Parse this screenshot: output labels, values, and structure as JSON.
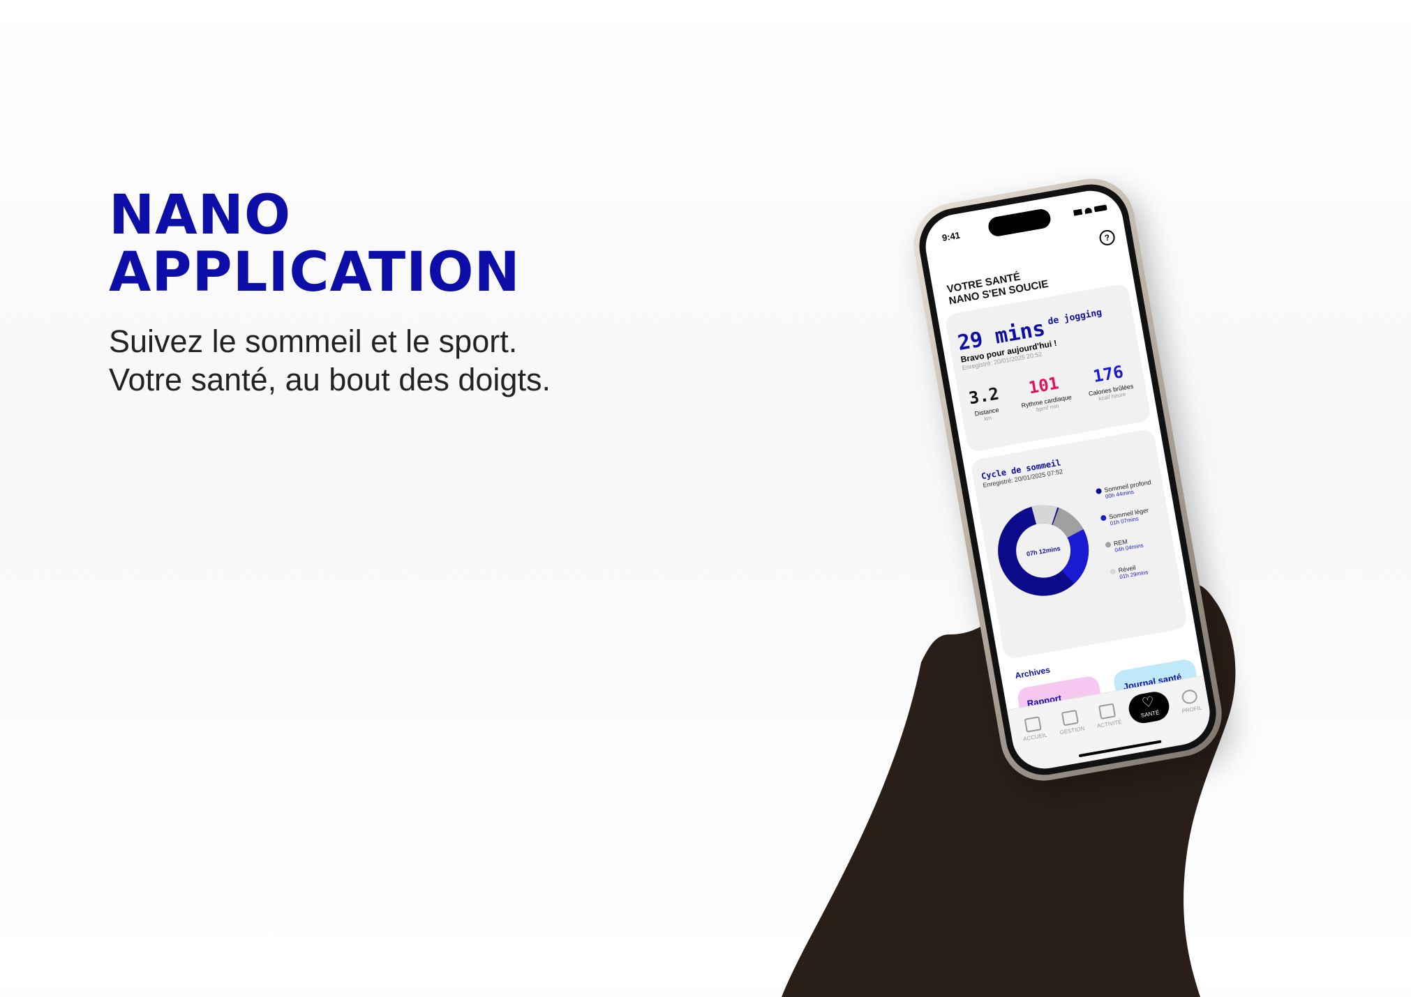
{
  "hero": {
    "title_line1": "NANO",
    "title_line2": "APPLICATION",
    "subtitle_line1": "Suivez le sommeil et le sport.",
    "subtitle_line2": "Votre santé, au bout des doigts."
  },
  "phone": {
    "status_time": "9:41",
    "help_label": "?",
    "header_line1": "VOTRE SANTÉ",
    "header_line2": "NANO S'EN SOUCIE",
    "activity": {
      "duration": "29 mins",
      "duration_suffix": "de jogging",
      "message": "Bravo pour aujourd'hui !",
      "recorded": "Enregistré: 20/01/2025  20:52",
      "stats": [
        {
          "value": "3.2",
          "label": "Distance",
          "unit": "km",
          "color": "#111111"
        },
        {
          "value": "101",
          "label": "Rythme cardiaque",
          "unit": "bpm/ min",
          "color": "#e0115f"
        },
        {
          "value": "176",
          "label": "Calories brûlées",
          "unit": "kcal/ heure",
          "color": "#1a1ad0"
        }
      ]
    },
    "sleep": {
      "title": "Cycle de sommeil",
      "recorded": "Enregistré: 20/01/2025  07:52",
      "total": "07h 12mins",
      "legend": [
        {
          "name": "Sommeil profond",
          "time": "00h 44mins",
          "color": "#0a0a8a"
        },
        {
          "name": "Sommeil léger",
          "time": "01h 07mins",
          "color": "#1a1ad0"
        },
        {
          "name": "REM",
          "time": "04h 04mins",
          "color": "#a0a0a0"
        },
        {
          "name": "Réveil",
          "time": "01h 29mins",
          "color": "#d6d6d6"
        }
      ]
    },
    "archives": {
      "title": "Archives",
      "tile1": "Rapport d'analyse",
      "tile2": "Journal santé"
    },
    "nav": {
      "home": "ACCUEIL",
      "gestion": "GESTION",
      "activite": "ACTIVITÉ",
      "sante": "SANTÉ",
      "profil": "PROFIL"
    }
  }
}
